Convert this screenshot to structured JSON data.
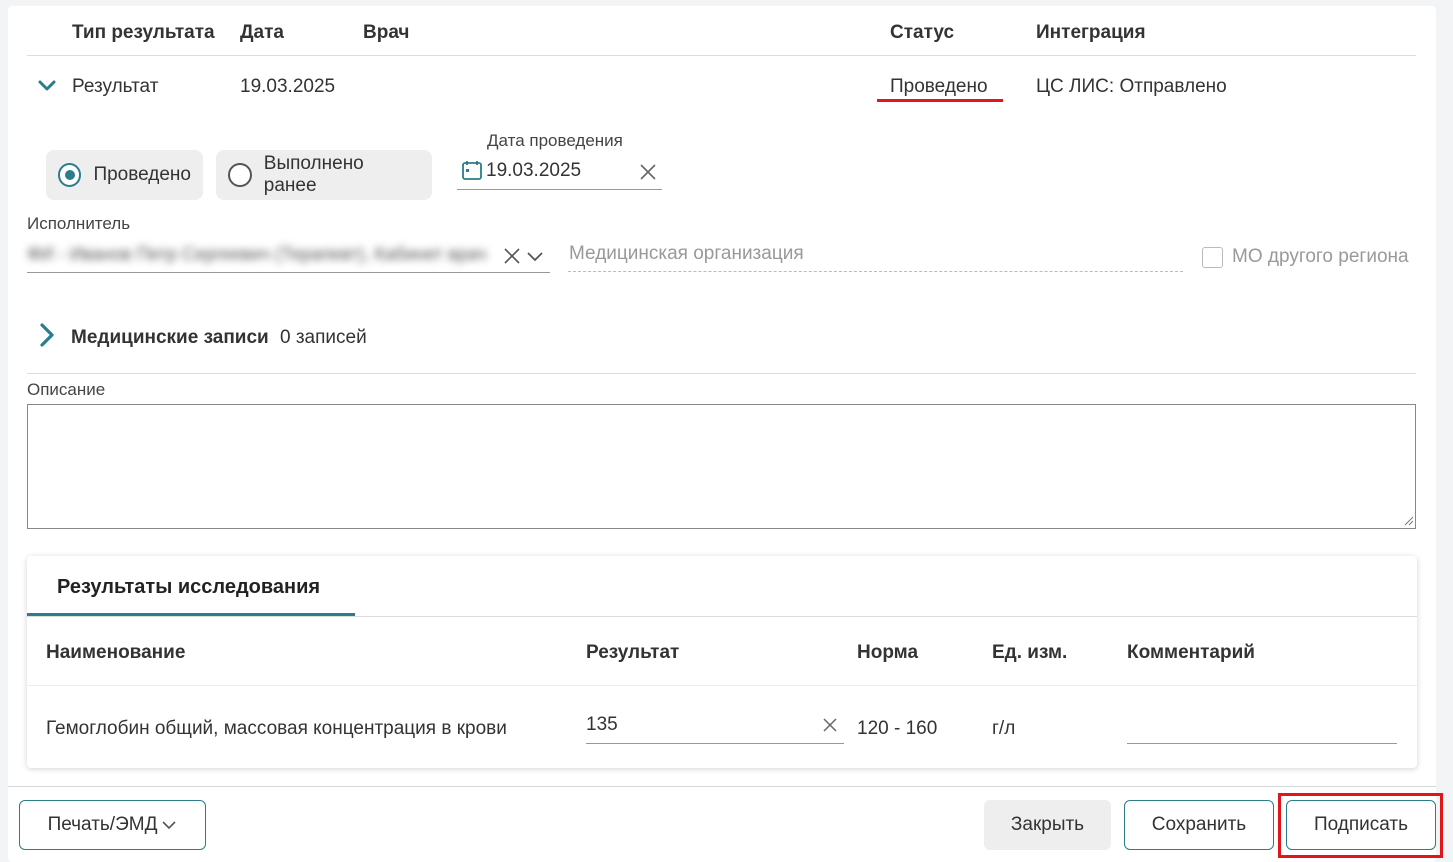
{
  "table_header": {
    "type": "Тип результата",
    "date": "Дата",
    "doctor": "Врач",
    "status": "Статус",
    "integration": "Интеграция"
  },
  "row": {
    "type": "Результат",
    "date": "19.03.2025",
    "status": "Проведено",
    "integration": "ЦС ЛИС: Отправлено"
  },
  "radios": {
    "option1": "Проведено",
    "option2": "Выполнено ранее",
    "selected": "Проведено"
  },
  "date_field": {
    "label": "Дата проведения",
    "value": "19.03.2025"
  },
  "executor": {
    "label": "Исполнитель",
    "value": "ФИ - Иванов Петр Сергеевич (Терапевт), Кабинет врач"
  },
  "med_org": {
    "placeholder": "Медицинская организация"
  },
  "other_region": {
    "label": "МО другого региона"
  },
  "med_records": {
    "title": "Медицинские записи",
    "count": "0 записей"
  },
  "description": {
    "label": "Описание",
    "value": ""
  },
  "results_panel": {
    "tab": "Результаты исследования",
    "columns": {
      "name": "Наименование",
      "result": "Результат",
      "norm": "Норма",
      "unit": "Ед. изм.",
      "comment": "Комментарий"
    },
    "rows": [
      {
        "name": "Гемоглобин общий, массовая концентрация в крови",
        "result": "135",
        "norm": "120 - 160",
        "unit": "г/л",
        "comment": ""
      }
    ]
  },
  "footer": {
    "print": "Печать/ЭМД",
    "close": "Закрыть",
    "save": "Сохранить",
    "sign": "Подписать"
  },
  "colors": {
    "accent": "#2a7d8a",
    "highlight": "#e0161b"
  }
}
